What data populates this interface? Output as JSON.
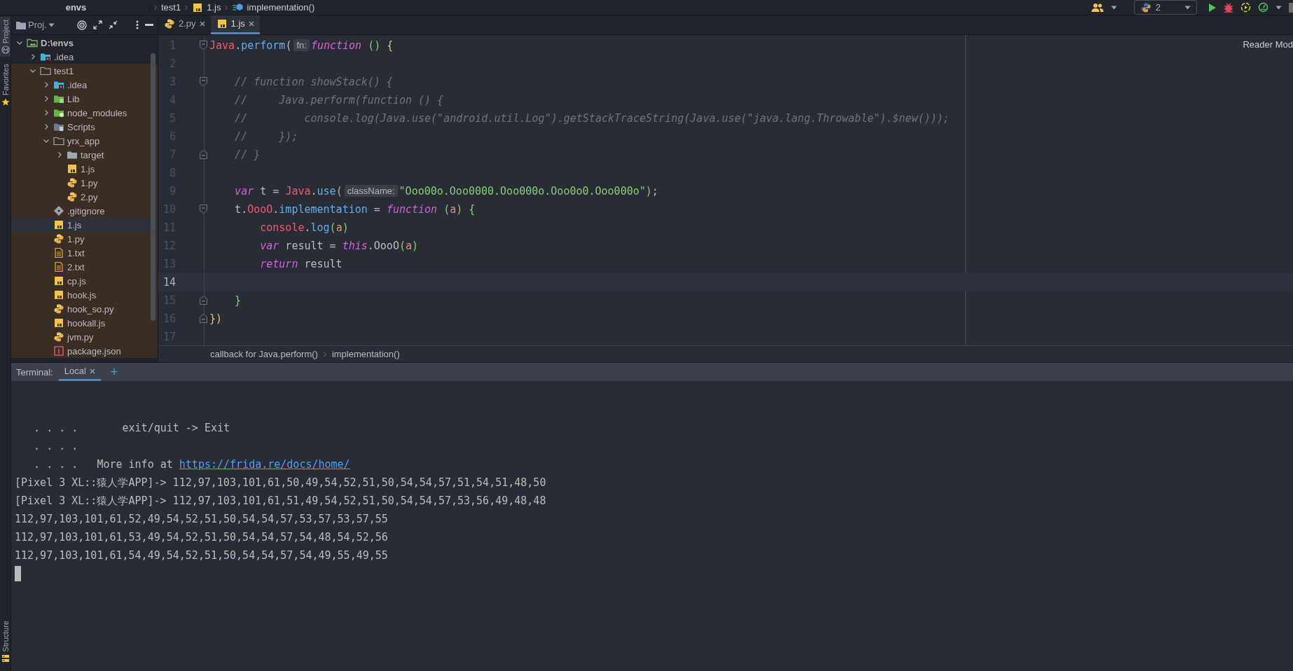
{
  "breadcrumbs": [
    {
      "label": "envs",
      "kind": "project"
    },
    {
      "label": "test1",
      "kind": "folder"
    },
    {
      "label": "1.js",
      "kind": "js"
    },
    {
      "label": "implementation()",
      "kind": "method"
    }
  ],
  "run_config": {
    "label": "2"
  },
  "tool_strip": {
    "top": [
      {
        "label": "Project",
        "kind": "project",
        "selected": true
      },
      {
        "label": "Favorites",
        "kind": "favorites",
        "selected": false
      }
    ],
    "bottom": [
      {
        "label": "Structure",
        "kind": "structure",
        "selected": false
      }
    ]
  },
  "project_panel": {
    "title": "Proj.",
    "tree": [
      {
        "label": "D:\\envs",
        "kind": "project",
        "expanded": true,
        "selected": false,
        "children": [
          {
            "label": ".idea",
            "kind": "idea",
            "expanded": false,
            "selected": false
          },
          {
            "label": "test1",
            "kind": "folder",
            "expanded": true,
            "tinted": true,
            "selected": false,
            "children": [
              {
                "label": ".idea",
                "kind": "idea",
                "expanded": false,
                "selected": false
              },
              {
                "label": "Lib",
                "kind": "lib",
                "expanded": false,
                "selected": false
              },
              {
                "label": "node_modules",
                "kind": "node",
                "expanded": false,
                "selected": false
              },
              {
                "label": "Scripts",
                "kind": "scripts",
                "expanded": false,
                "selected": false
              },
              {
                "label": "yrx_app",
                "kind": "folder",
                "expanded": true,
                "selected": false,
                "children": [
                  {
                    "label": "target",
                    "kind": "target",
                    "expanded": false,
                    "selected": false
                  },
                  {
                    "label": "1.js",
                    "kind": "js",
                    "selected": false
                  },
                  {
                    "label": "1.py",
                    "kind": "py",
                    "selected": false
                  },
                  {
                    "label": "2.py",
                    "kind": "py",
                    "selected": false
                  }
                ]
              },
              {
                "label": ".gitignore",
                "kind": "git",
                "selected": false
              },
              {
                "label": "1.js",
                "kind": "js",
                "selected": true
              },
              {
                "label": "1.py",
                "kind": "py",
                "selected": false
              },
              {
                "label": "1.txt",
                "kind": "txt",
                "selected": false
              },
              {
                "label": "2.txt",
                "kind": "txt",
                "selected": false
              },
              {
                "label": "cp.js",
                "kind": "js",
                "selected": false
              },
              {
                "label": "hook.js",
                "kind": "js",
                "selected": false
              },
              {
                "label": "hook_so.py",
                "kind": "py",
                "selected": false
              },
              {
                "label": "hookall.js",
                "kind": "js",
                "selected": false
              },
              {
                "label": "jvm.py",
                "kind": "py",
                "selected": false
              },
              {
                "label": "package.json",
                "kind": "json",
                "selected": false
              }
            ]
          }
        ]
      }
    ]
  },
  "editor": {
    "tabs": [
      {
        "label": "2.py",
        "kind": "py",
        "selected": false
      },
      {
        "label": "1.js",
        "kind": "js",
        "selected": true
      }
    ],
    "reader_mode": "Reader Mod",
    "lines": [
      {
        "number": "1",
        "fold_start": true,
        "fold_end": false,
        "current": false,
        "tokens": [
          {
            "kind": "global",
            "text": "Java"
          },
          {
            "kind": "plain",
            "text": "."
          },
          {
            "kind": "member",
            "text": "perform"
          },
          {
            "kind": "plain",
            "text": "("
          },
          {
            "kind": "hint",
            "text": "fn:"
          },
          {
            "kind": "keyword",
            "text": "function"
          },
          {
            "kind": "brace2",
            "text": " ()"
          },
          {
            "kind": "brace1",
            "text": " {"
          }
        ]
      },
      {
        "number": "2",
        "fold_start": false,
        "fold_end": false,
        "current": false
      },
      {
        "number": "3",
        "fold_start": true,
        "fold_end": false,
        "current": false,
        "tokens": [
          {
            "kind": "comment",
            "text": "    // function showStack() {"
          }
        ]
      },
      {
        "number": "4",
        "fold_start": false,
        "fold_end": false,
        "current": false,
        "tokens": [
          {
            "kind": "comment",
            "text": "    //     Java.perform(function () {"
          }
        ]
      },
      {
        "number": "5",
        "fold_start": false,
        "fold_end": false,
        "current": false,
        "tokens": [
          {
            "kind": "comment",
            "text": "    //         console.log(Java.use(\"android.util.Log\").getStackTraceString(Java.use(\"java.lang.Throwable\").$new()));"
          }
        ]
      },
      {
        "number": "6",
        "fold_start": false,
        "fold_end": false,
        "current": false,
        "tokens": [
          {
            "kind": "comment",
            "text": "    //     });"
          }
        ]
      },
      {
        "number": "7",
        "fold_start": false,
        "fold_end": true,
        "current": false,
        "tokens": [
          {
            "kind": "comment",
            "text": "    // }"
          }
        ]
      },
      {
        "number": "8",
        "fold_start": false,
        "fold_end": false,
        "current": false
      },
      {
        "number": "9",
        "fold_start": false,
        "fold_end": false,
        "current": false,
        "tokens": [
          {
            "kind": "keyword",
            "text": "    var"
          },
          {
            "kind": "plain",
            "text": " t = "
          },
          {
            "kind": "global",
            "text": "Java"
          },
          {
            "kind": "plain",
            "text": "."
          },
          {
            "kind": "member",
            "text": "use"
          },
          {
            "kind": "brace2",
            "text": "("
          },
          {
            "kind": "hint",
            "text": "className:"
          },
          {
            "kind": "string",
            "text": "\"Ooo00o.Ooo0000.Ooo000o.Ooo0o0.Ooo000o\""
          },
          {
            "kind": "brace2",
            "text": ")"
          },
          {
            "kind": "plain",
            "text": ";"
          }
        ]
      },
      {
        "number": "10",
        "fold_start": true,
        "fold_end": false,
        "current": false,
        "tokens": [
          {
            "kind": "plain",
            "text": "    t."
          },
          {
            "kind": "global",
            "text": "OooO"
          },
          {
            "kind": "plain",
            "text": "."
          },
          {
            "kind": "member",
            "text": "implementation"
          },
          {
            "kind": "plain",
            "text": " = "
          },
          {
            "kind": "keyword",
            "text": "function"
          },
          {
            "kind": "brace2",
            "text": " ("
          },
          {
            "kind": "param",
            "text": "a"
          },
          {
            "kind": "brace2",
            "text": ")"
          },
          {
            "kind": "brace2",
            "text": " {"
          }
        ]
      },
      {
        "number": "11",
        "fold_start": false,
        "fold_end": false,
        "current": false,
        "tokens": [
          {
            "kind": "global",
            "text": "        console"
          },
          {
            "kind": "plain",
            "text": "."
          },
          {
            "kind": "member",
            "text": "log"
          },
          {
            "kind": "brace2",
            "text": "("
          },
          {
            "kind": "param",
            "text": "a"
          },
          {
            "kind": "brace2",
            "text": ")"
          }
        ]
      },
      {
        "number": "12",
        "fold_start": false,
        "fold_end": false,
        "current": false,
        "tokens": [
          {
            "kind": "keyword",
            "text": "        var"
          },
          {
            "kind": "plain",
            "text": " result = "
          },
          {
            "kind": "keyword",
            "text": "this"
          },
          {
            "kind": "plain",
            "text": ".OooO"
          },
          {
            "kind": "brace2",
            "text": "("
          },
          {
            "kind": "param",
            "text": "a"
          },
          {
            "kind": "brace2",
            "text": ")"
          }
        ]
      },
      {
        "number": "13",
        "fold_start": false,
        "fold_end": false,
        "current": false,
        "tokens": [
          {
            "kind": "keyword",
            "text": "        return"
          },
          {
            "kind": "plain",
            "text": " result"
          }
        ]
      },
      {
        "number": "14",
        "fold_start": false,
        "fold_end": false,
        "current": true
      },
      {
        "number": "15",
        "fold_start": false,
        "fold_end": true,
        "current": false,
        "tokens": [
          {
            "kind": "brace2",
            "text": "    }"
          }
        ]
      },
      {
        "number": "16",
        "fold_start": false,
        "fold_end": true,
        "current": false,
        "tokens": [
          {
            "kind": "brace1",
            "text": "})"
          }
        ]
      },
      {
        "number": "17",
        "fold_start": false,
        "fold_end": false,
        "current": false
      }
    ],
    "breadcrumbs": [
      "callback for Java.perform()",
      "implementation()"
    ]
  },
  "terminal": {
    "title": "Terminal:",
    "tabs": [
      {
        "label": "Local",
        "selected": true
      }
    ],
    "add": "+",
    "cursor": true,
    "lines": [
      {
        "segments": [
          {
            "kind": "text",
            "text": "   . . . .       exit/quit -> Exit"
          }
        ]
      },
      {
        "segments": [
          {
            "kind": "text",
            "text": "   . . . ."
          }
        ]
      },
      {
        "segments": [
          {
            "kind": "text",
            "text": "   . . . .   More info at "
          },
          {
            "kind": "link",
            "text": "https://frida.re/docs/home/"
          }
        ]
      },
      {
        "segments": [
          {
            "kind": "text",
            "text": "[Pixel 3 XL::猿人学APP]-> 112,97,103,101,61,50,49,54,52,51,50,54,54,57,51,54,51,48,50"
          }
        ]
      },
      {
        "segments": [
          {
            "kind": "text",
            "text": "[Pixel 3 XL::猿人学APP]-> 112,97,103,101,61,51,49,54,52,51,50,54,54,57,53,56,49,48,48"
          }
        ]
      },
      {
        "segments": [
          {
            "kind": "text",
            "text": "112,97,103,101,61,52,49,54,52,51,50,54,54,57,53,57,53,57,55"
          }
        ]
      },
      {
        "segments": [
          {
            "kind": "text",
            "text": "112,97,103,101,61,53,49,54,52,51,50,54,54,57,54,48,54,52,56"
          }
        ]
      },
      {
        "segments": [
          {
            "kind": "text",
            "text": "112,97,103,101,61,54,49,54,52,51,50,54,54,57,54,49,55,49,55"
          }
        ]
      }
    ]
  }
}
